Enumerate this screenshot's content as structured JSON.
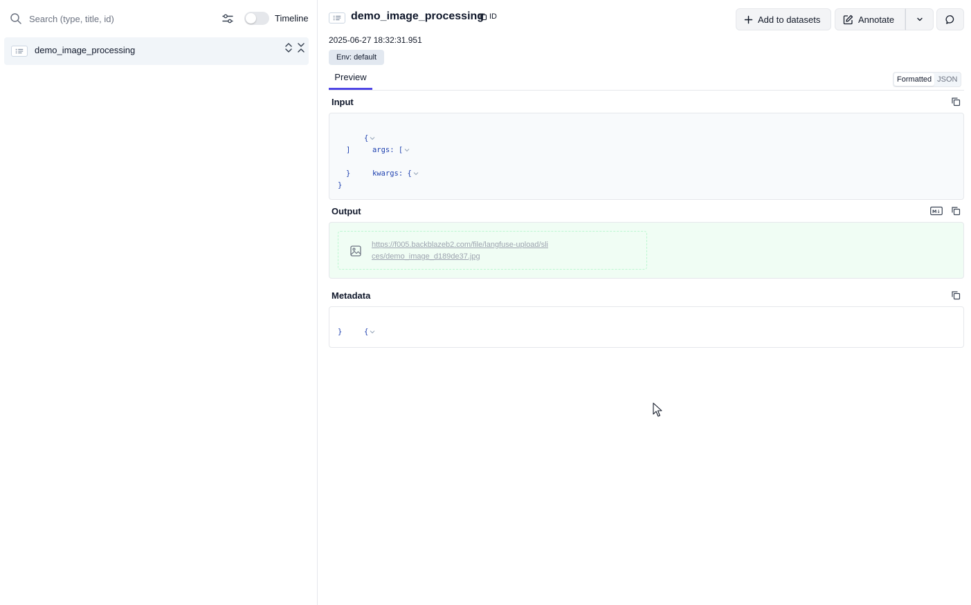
{
  "sidebar": {
    "search_placeholder": "Search (type, title, id)",
    "search_value": "",
    "timeline_label": "Timeline",
    "timeline_enabled": false,
    "tree": [
      {
        "label": "demo_image_processing"
      }
    ]
  },
  "header": {
    "title": "demo_image_processing",
    "id_label": "ID",
    "timestamp": "2025-06-27 18:32:31.951",
    "env_badge": "Env: default",
    "add_to_datasets_label": "Add to datasets",
    "annotate_label": "Annotate"
  },
  "tabs": {
    "preview": "Preview",
    "format_options": [
      "Formatted",
      "JSON"
    ],
    "format_selected": "Formatted"
  },
  "input": {
    "title": "Input",
    "lines": [
      "{",
      "args: [",
      "]",
      "kwargs: {",
      "}",
      "}"
    ]
  },
  "output": {
    "title": "Output",
    "media_url": "https://f005.backblazeb2.com/file/langfuse-upload/slices/demo_image_d189de37.jpg",
    "md_label": "M↓"
  },
  "metadata": {
    "title": "Metadata",
    "lines": [
      "{",
      "}"
    ]
  },
  "colors": {
    "accent": "#4f46e5",
    "output_bg": "#f0fdf4",
    "json_text": "#1e40af"
  }
}
